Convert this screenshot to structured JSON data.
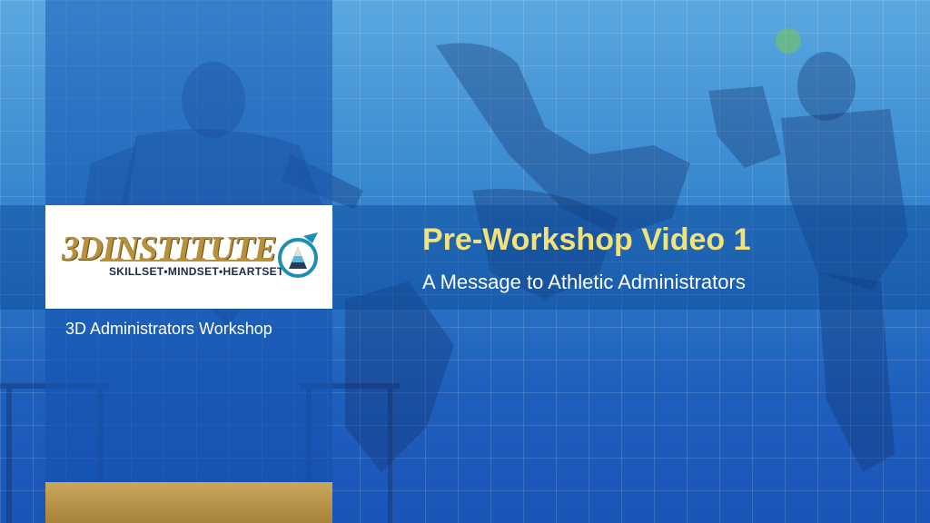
{
  "slide": {
    "title": "Pre-Workshop Video 1",
    "subtitle": "A Message to Athletic Administrators",
    "workshop_label": "3D Administrators Workshop"
  },
  "logo": {
    "name": "3DINSTITUTE",
    "tagline": "SKILLSET•MINDSET•HEARTSET"
  },
  "colors": {
    "title": "#f2e27a",
    "accent_gold": "#b8903a",
    "background_blue": "#2f7fcb"
  }
}
